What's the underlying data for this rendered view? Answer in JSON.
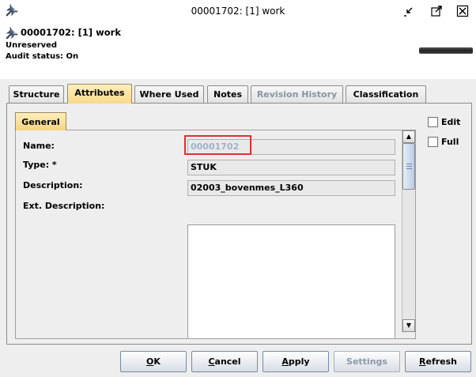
{
  "window": {
    "title": "00001702: [1] work",
    "icon": "pin-icon"
  },
  "header": {
    "title": "00001702: [1] work",
    "reserve_status": "Unreserved",
    "audit_status": "Audit status: On"
  },
  "tabs": [
    {
      "label": "Structure",
      "state": "normal"
    },
    {
      "label": "Attributes",
      "state": "active"
    },
    {
      "label": "Where Used",
      "state": "normal"
    },
    {
      "label": "Notes",
      "state": "normal"
    },
    {
      "label": "Revision History",
      "state": "disabled"
    },
    {
      "label": "Classification",
      "state": "normal"
    }
  ],
  "general_tab": {
    "label": "General"
  },
  "form": {
    "name_label": "Name:",
    "name_value": "00001702",
    "type_label": "Type: *",
    "type_value": "STUK",
    "description_label": "Description:",
    "description_value": "02003_bovenmes_L360",
    "ext_description_label": "Ext. Description:",
    "ext_description_value": ""
  },
  "options": {
    "edit_label": "Edit",
    "edit_checked": false,
    "full_label": "Full",
    "full_checked": false
  },
  "buttons": {
    "ok": {
      "mn": "O",
      "rest": "K"
    },
    "cancel": {
      "mn": "C",
      "rest": "ancel"
    },
    "apply": {
      "mn": "A",
      "rest": "pply"
    },
    "settings": {
      "label": "Settings",
      "enabled": false
    },
    "refresh": {
      "mn": "R",
      "rest": "efresh"
    }
  },
  "colors": {
    "active_tab": "#f8d98a",
    "highlight": "#e03030",
    "disabled_text": "#9fb2c8"
  }
}
